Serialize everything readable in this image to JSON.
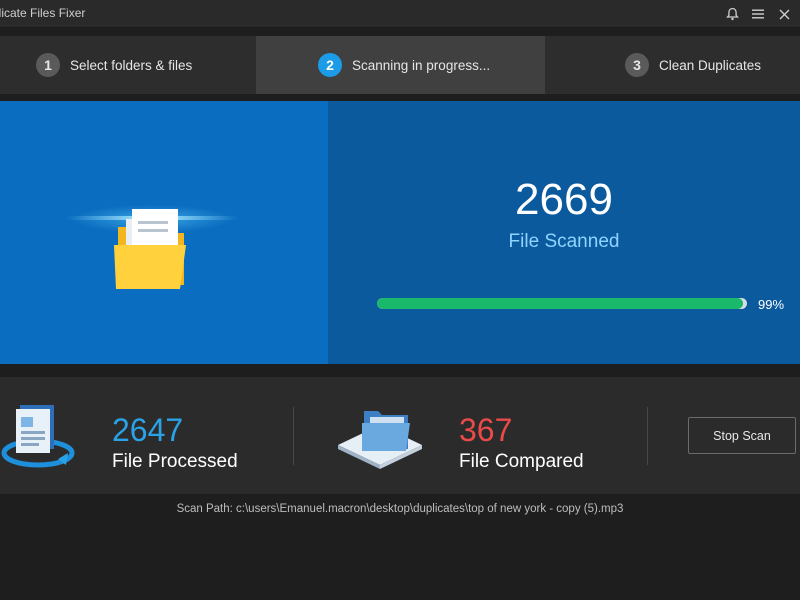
{
  "window": {
    "title": "plicate Files Fixer",
    "icons": [
      "bell-icon",
      "menu-icon",
      "close-icon"
    ]
  },
  "steps": [
    {
      "number": "1",
      "label": "Select folders & files",
      "active": false
    },
    {
      "number": "2",
      "label": "Scanning in progress...",
      "active": true
    },
    {
      "number": "3",
      "label": "Clean Duplicates",
      "active": false
    }
  ],
  "scan": {
    "count": "2669",
    "label": "File Scanned",
    "progress_percent": 99,
    "progress_text": "99%"
  },
  "stats": {
    "processed": {
      "count": "2647",
      "label": "File Processed",
      "color": "#2aa3e6"
    },
    "compared": {
      "count": "367",
      "label": "File Compared",
      "color": "#ea4a4a"
    }
  },
  "actions": {
    "stop_label": "Stop Scan"
  },
  "footer": {
    "scan_path_label": "Scan Path:",
    "scan_path": "c:\\users\\Emanuel.macron\\desktop\\duplicates\\top of new york - copy (5).mp3"
  },
  "colors": {
    "accent": "#1c9be6",
    "progress": "#19b86a",
    "panel_left": "#0b6dc0",
    "panel_right": "#0c5a9e"
  }
}
